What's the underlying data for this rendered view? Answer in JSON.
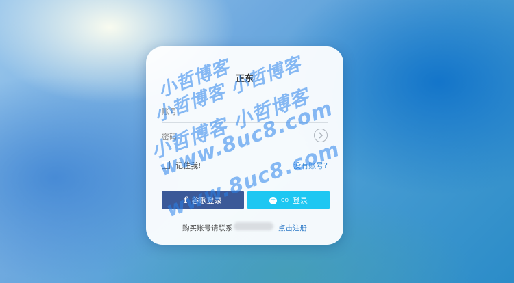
{
  "login": {
    "title": "正东",
    "username_placeholder": "账号",
    "password_placeholder": "密码",
    "remember_label": "记住我!",
    "no_account_link": "没有账号?",
    "facebook_button": "谷歌登录",
    "qq_small_label": "QQ",
    "qq_button": "登录",
    "footer_text": "购买账号请联系",
    "register_link": "点击注册"
  },
  "watermarks": [
    "小哲博客",
    "小哲博客 小哲博客",
    "小哲博客 小哲博客",
    "www.8uc8.com",
    "www.8uc8.com"
  ],
  "colors": {
    "facebook_blue": "#3b5998",
    "qq_cyan": "#1ec7f2",
    "link_blue": "#2a78c6",
    "watermark_blue": "#2882eb"
  },
  "icons": {
    "password_toggle": "eye-icon",
    "facebook": "facebook-icon",
    "qq": "qq-icon"
  }
}
